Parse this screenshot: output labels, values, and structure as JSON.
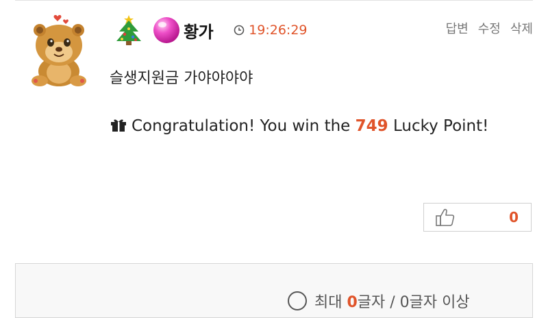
{
  "comment": {
    "author": {
      "nickname": "황가",
      "avatar_icon": "cartoon-lion-cub-avatar",
      "badges": [
        "christmas-tree-icon",
        "pink-ball-icon"
      ]
    },
    "time": "19:26:29",
    "actions": {
      "reply": "답변",
      "edit": "수정",
      "delete": "삭제"
    },
    "text": "슬생지원금 가야야야야",
    "lucky": {
      "prefix": "Congratulation! You win the ",
      "points": "749",
      "suffix": " Lucky Point!"
    },
    "likes": {
      "count": "0"
    }
  },
  "reply_box": {
    "hint_prefix": "최대 ",
    "hint_count_red": "0",
    "hint_rest": "글자 / 0글자 이상"
  },
  "colors": {
    "accent": "#e0542a",
    "muted": "#777777",
    "border": "#cfcfcf"
  }
}
